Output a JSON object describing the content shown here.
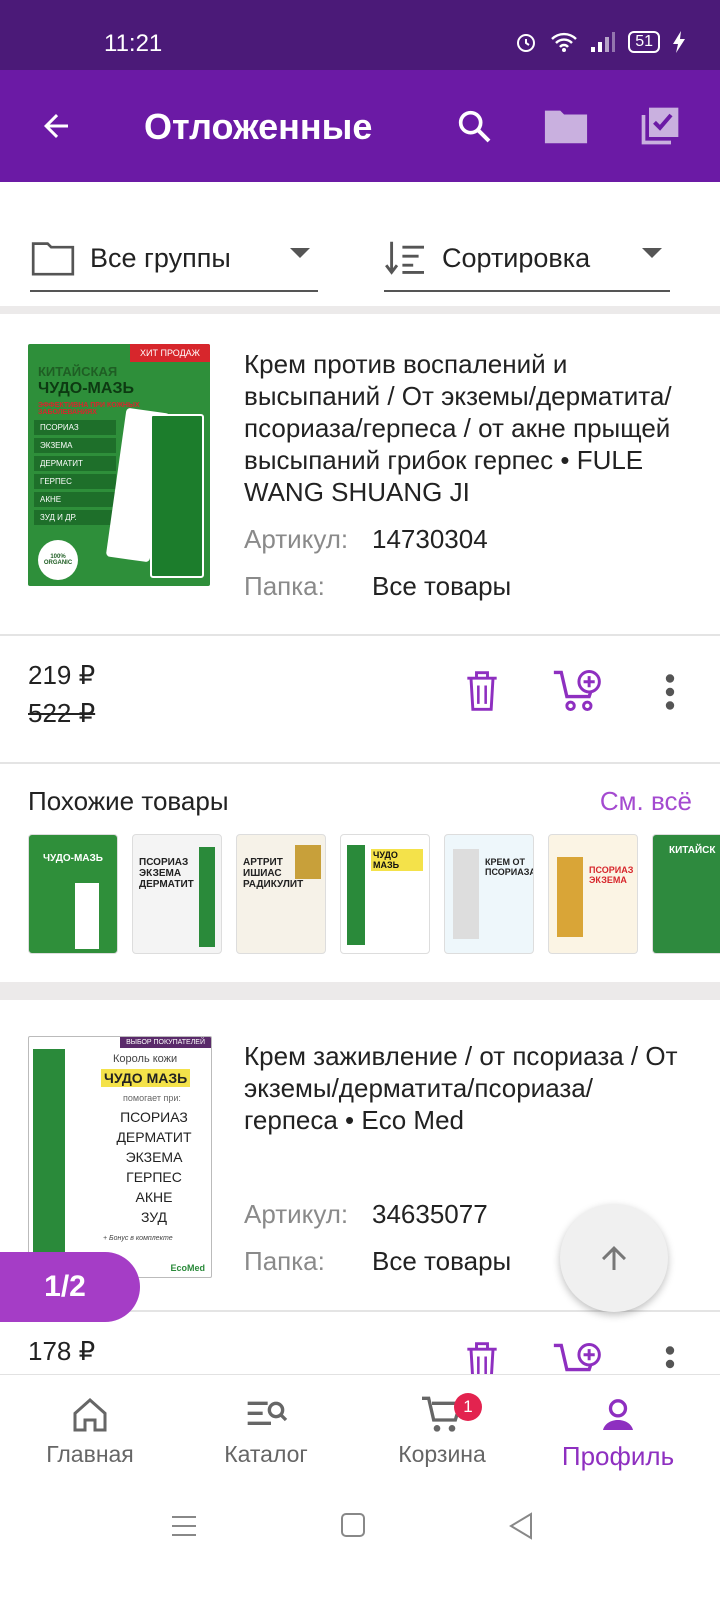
{
  "status_bar": {
    "time": "11:21",
    "battery": "51"
  },
  "app_bar": {
    "title": "Отложенные"
  },
  "filters": {
    "group_label": "Все группы",
    "sort_label": "Сортировка"
  },
  "product1": {
    "name": "Крем против воспалений и высыпаний / От экземы/дерматита/псориаза/герпеса / от акне прыщей высыпаний грибок герпес • FULE WANG SHUANG JI",
    "article_label": "Артикул:",
    "article": "14730304",
    "folder_label": "Папка:",
    "folder": "Все товары",
    "price": "219 ₽",
    "old_price": "522 ₽",
    "image": {
      "badge": "ХИТ ПРОДАЖ",
      "headline1": "КИТАЙСКАЯ",
      "headline2": "ЧУДО-МАЗЬ",
      "subtitle": "ЭФФЕКТИВНА ПРИ КОЖНЫХ ЗАБОЛЕВАНИЯХ",
      "items": [
        "ПСОРИАЗ",
        "ЭКЗЕМА",
        "ДЕРМАТИТ",
        "ГЕРПЕС",
        "АКНЕ",
        "ЗУД И ДР."
      ],
      "seal": "100% ORGANIC"
    }
  },
  "similar": {
    "title": "Похожие товары",
    "see_all": "См. всё",
    "items": [
      {
        "label": "ЧУДО-МАЗЬ",
        "bg": "#2f8f3a"
      },
      {
        "label": "ПСОРИАЗ ЭКЗЕМА ДЕРМАТИТ",
        "bg": "#f4f4f4"
      },
      {
        "label": "АРТРИТ ИШИАС РАДИКУЛИТ",
        "bg": "#f6f2e8"
      },
      {
        "label": "ЧУДО МАЗЬ",
        "bg": "#ffffff"
      },
      {
        "label": "КРЕМ ОТ ПСОРИАЗА",
        "bg": "#eef7fb"
      },
      {
        "label": "ПСОРИАЗ ЭКЗЕМА",
        "bg": "#fbf4e4"
      },
      {
        "label": "КИТАЙСК",
        "bg": "#2e8a3e"
      }
    ]
  },
  "product2": {
    "name": "Крем заживление / от псориаза / От экземы/дерматита/псориаза/ герпеса • Eco Med",
    "article_label": "Артикул:",
    "article": "34635077",
    "folder_label": "Папка:",
    "folder": "Все товары",
    "price": "178 ₽",
    "image": {
      "badge": "ВЫБОР ПОКУПАТЕЛЕЙ",
      "line1": "Король кожи",
      "line2": "ЧУДО МАЗЬ",
      "line3": "помогает при:",
      "items": [
        "ПСОРИАЗ",
        "ДЕРМАТИТ",
        "ЭКЗЕМА",
        "ГЕРПЕС",
        "АКНЕ",
        "ЗУД"
      ],
      "bonus": "+ Бонус в комплекте",
      "brand": "EcoMed"
    }
  },
  "pager": "1/2",
  "bottom_nav": {
    "home": "Главная",
    "catalog": "Каталог",
    "cart": "Корзина",
    "cart_badge": "1",
    "profile": "Профиль"
  },
  "colors": {
    "primary": "#6b1aa5",
    "status": "#4b1a78",
    "accent": "#8e2fc0",
    "badge": "#e3234f"
  }
}
